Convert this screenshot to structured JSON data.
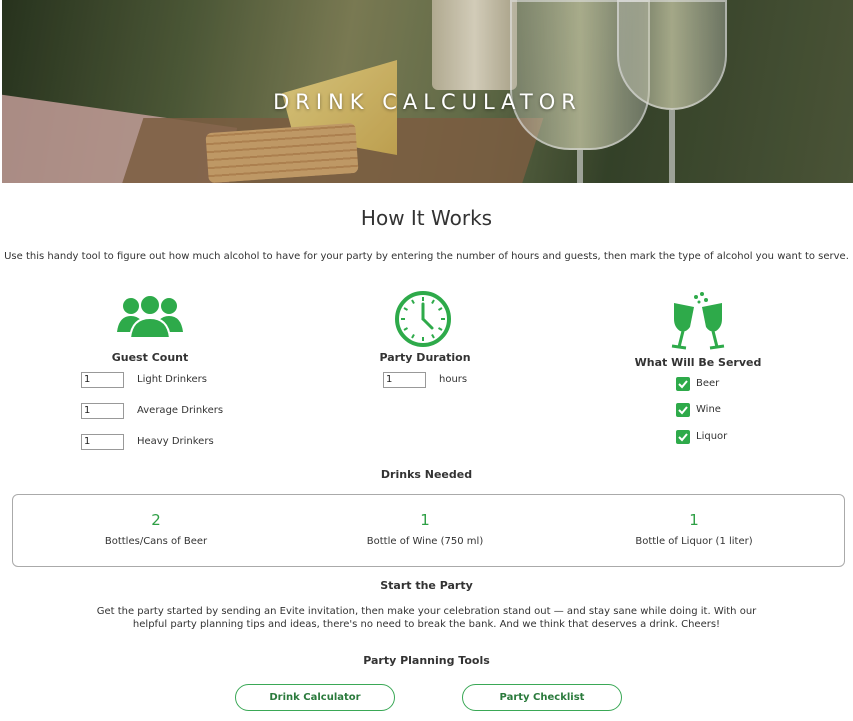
{
  "hero": {
    "title": "DRINK CALCULATOR"
  },
  "how": {
    "title": "How It Works",
    "intro": "Use this handy tool to figure out how much alcohol to have for your party by entering the number of hours and guests, then mark the type of alcohol you want to serve."
  },
  "guests": {
    "label": "Guest Count",
    "rows": [
      {
        "value": "1",
        "label": "Light Drinkers"
      },
      {
        "value": "1",
        "label": "Average Drinkers"
      },
      {
        "value": "1",
        "label": "Heavy Drinkers"
      }
    ]
  },
  "duration": {
    "label": "Party Duration",
    "value": "1",
    "unit": "hours"
  },
  "served": {
    "label": "What Will Be Served",
    "options": [
      {
        "label": "Beer",
        "checked": true
      },
      {
        "label": "Wine",
        "checked": true
      },
      {
        "label": "Liquor",
        "checked": true
      }
    ]
  },
  "drinks_needed": {
    "title": "Drinks Needed",
    "results": [
      {
        "count": "2",
        "label": "Bottles/Cans of Beer"
      },
      {
        "count": "1",
        "label": "Bottle of Wine (750 ml)"
      },
      {
        "count": "1",
        "label": "Bottle of Liquor (1 liter)"
      }
    ]
  },
  "start": {
    "title": "Start the Party",
    "text": "Get the party started by sending an Evite invitation, then make your celebration stand out — and stay sane while doing it. With our helpful party planning tips and ideas, there's no need to break the bank. And we think that deserves a drink. Cheers!"
  },
  "tools": {
    "title": "Party Planning Tools",
    "buttons": [
      "Drink Calculator",
      "Party Checklist"
    ]
  },
  "colors": {
    "accent": "#2eaa4a"
  }
}
